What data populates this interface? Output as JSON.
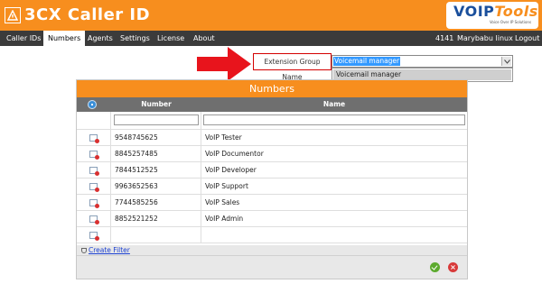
{
  "app": {
    "title": "3CX Caller ID",
    "brand_logo_text": "VOIPTools",
    "brand_tagline": "Voice Over IP Solutions"
  },
  "nav": {
    "items": [
      {
        "label": "Caller IDs"
      },
      {
        "label": "Numbers",
        "active": true
      },
      {
        "label": "Agents"
      },
      {
        "label": "Settings"
      },
      {
        "label": "License"
      },
      {
        "label": "About"
      }
    ],
    "user_ext": "4141",
    "user_name": "Marybabu linux",
    "logout_label": "Logout"
  },
  "filter": {
    "label": "Extension Group Name",
    "selected": "Voicemail manager",
    "dropdown_option": "Voicemail manager"
  },
  "panel": {
    "title": "Numbers",
    "columns": [
      "Number",
      "Name"
    ],
    "rows": [
      {
        "number": "9548745625",
        "name": "VoIP Tester"
      },
      {
        "number": "8845257485",
        "name": "VoIP Documentor"
      },
      {
        "number": "7844512525",
        "name": "VoIP Developer"
      },
      {
        "number": "9963652563",
        "name": "VoIP Support"
      },
      {
        "number": "7744585256",
        "name": "VoIP Sales"
      },
      {
        "number": "8852521252",
        "name": "VoIP Admin"
      },
      {
        "number": "",
        "name": ""
      }
    ],
    "create_filter_label": "Create Filter"
  },
  "colors": {
    "accent": "#f78e1e",
    "nav_bg": "#3b3b3b",
    "header_row_bg": "#6f6f6f",
    "highlight_border": "#d40000",
    "arrow": "#e8141c"
  },
  "icons": [
    "logo-triangle-icon",
    "arrow-pointer-icon",
    "add-icon",
    "row-edit-icon",
    "filter-icon",
    "ok-icon",
    "cancel-icon"
  ]
}
